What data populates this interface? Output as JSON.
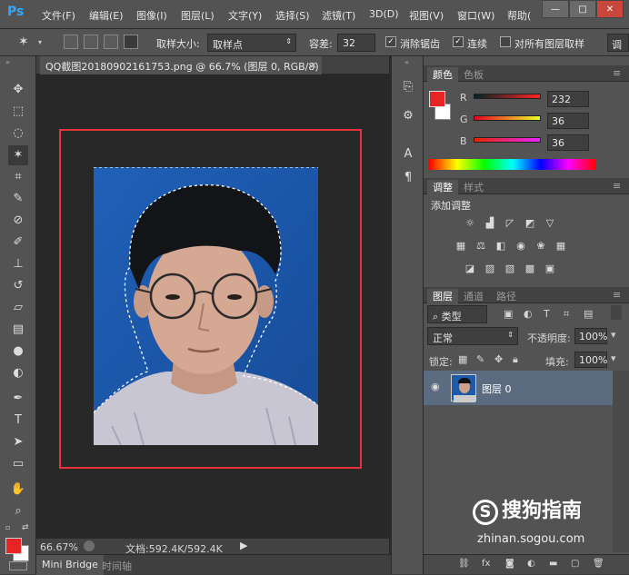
{
  "app": {
    "logo": "Ps"
  },
  "menu": [
    "文件(F)",
    "编辑(E)",
    "图像(I)",
    "图层(L)",
    "文字(Y)",
    "选择(S)",
    "滤镜(T)",
    "3D(D)",
    "视图(V)",
    "窗口(W)",
    "帮助("
  ],
  "window_controls": [
    "—",
    "□",
    "✕"
  ],
  "options": {
    "sample_size_label": "取样大小:",
    "sample_size_value": "取样点",
    "tolerance_label": "容差:",
    "tolerance_value": "32",
    "antialias_label": "消除锯齿",
    "contiguous_label": "连续",
    "all_layers_label": "对所有图层取样",
    "refine_label": "调"
  },
  "document": {
    "tab_title": "QQ截图20180902161753.png @ 66.7% (图层 0, RGB/8) *",
    "close": "×"
  },
  "status": {
    "zoom": "66.67%",
    "doc_info": "文档:592.4K/592.4K"
  },
  "bottom_tabs": [
    "Mini Bridge",
    "时间轴"
  ],
  "color_panel": {
    "tabs": [
      "颜色",
      "色板"
    ],
    "r_label": "R",
    "r_value": "232",
    "g_label": "G",
    "g_value": "36",
    "b_label": "B",
    "b_value": "36",
    "fg_color": "#e82424"
  },
  "adjust_panel": {
    "tabs": [
      "调整",
      "样式"
    ],
    "title": "添加调整"
  },
  "layers_panel": {
    "tabs": [
      "图层",
      "通道",
      "路径"
    ],
    "filter_label": "类型",
    "blend_mode": "正常",
    "opacity_label": "不透明度:",
    "opacity_value": "100%",
    "lock_label": "锁定:",
    "fill_label": "填充:",
    "fill_value": "100%",
    "layer_name": "图层 0"
  },
  "watermark": {
    "brand": "搜狗指南",
    "url": "zhinan.sogou.com"
  }
}
